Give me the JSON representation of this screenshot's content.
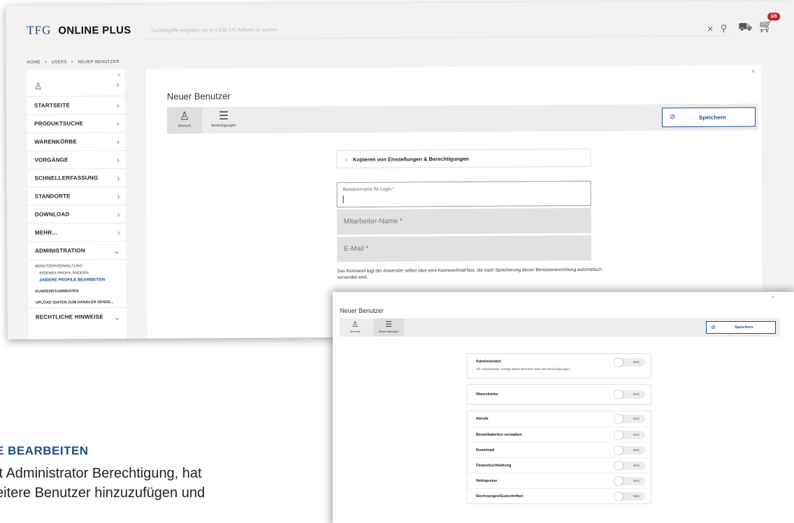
{
  "app": {
    "logo_mark": "TFG",
    "brand": "ONLINE PLUS"
  },
  "search": {
    "placeholder": "Suchbegriffe eingeben um in 4.538.231 Artikeln zu suchen"
  },
  "cart": {
    "badge": "3/6"
  },
  "breadcrumb": [
    "HOME",
    ">",
    "USERS",
    ">",
    "NEUER BENUTZER"
  ],
  "sidebar": {
    "items": [
      {
        "label": "STARTSEITE"
      },
      {
        "label": "PRODUKTSUCHE"
      },
      {
        "label": "WARENKÖRBE"
      },
      {
        "label": "VORGÄNGE"
      },
      {
        "label": "SCHNELLERFASSUNG"
      },
      {
        "label": "STANDORTE"
      },
      {
        "label": "DOWNLOAD"
      },
      {
        "label": "MEHR..."
      },
      {
        "label": "ADMINISTRATION"
      }
    ],
    "sub": {
      "section1": "BENUTZERVERWALTUNG",
      "item1": "EIGENES PROFIL ÄNDERN",
      "item2_active": "ANDERE PROFILE BEARBEITEN",
      "section2": "KUNDENSTAMMDATEN",
      "section3": "UPLOAD (DATEN ZUM HÄNDLER SENDE..."
    },
    "last_item": "RECHTLICHE HINWEISE"
  },
  "main": {
    "title": "Neuer Benutzer",
    "tabs": [
      {
        "label": "Account"
      },
      {
        "label": "Berechtigungen"
      }
    ],
    "save_label": "Speichern",
    "copy_settings": "Kopieren von Einstellungen & Berechtigungen",
    "fields": {
      "username_label": "Benutzername für Login *",
      "employee_name": "Mitarbeiter-Name *",
      "email": "E-Mail *"
    },
    "note": "Das Kennwort legt der Anwender selbst über eine Kennwortmail fest, die nach Speicherung dieser Benutzereinrichtung automatisch versendet wird."
  },
  "overlay": {
    "title": "Neuer Benutzer",
    "tabs": [
      {
        "label": "Account"
      },
      {
        "label": "Berechtigungen"
      }
    ],
    "save_label": "Speichern",
    "permissions": {
      "admin": {
        "label": "Administrator",
        "desc": "Als Administrator, verfügt dieser Benutzer über alle Berechtigungen.",
        "value": "Nein"
      },
      "warenkoerbe": {
        "label": "Warenkörbe",
        "value": "Nein"
      },
      "list": [
        {
          "label": "Abrufe",
          "value": "Nein"
        },
        {
          "label": "Bestelltabellen verwalten",
          "value": "Nein"
        },
        {
          "label": "Download",
          "value": "Nein"
        },
        {
          "label": "Finanzbuchhaltung",
          "value": "Nein"
        },
        {
          "label": "Nettopreise",
          "value": "Nein"
        },
        {
          "label": "Rechnungen/Gutschriften",
          "value": "Nein"
        }
      ]
    }
  },
  "doc": {
    "heading": "E BEARBEITEN",
    "para": "it Administrator Berechtigung, hat\neitere Benutzer hinzuzufügen und"
  },
  "colors": {
    "accent": "#1c4f8f",
    "badge": "#c21a1a"
  }
}
